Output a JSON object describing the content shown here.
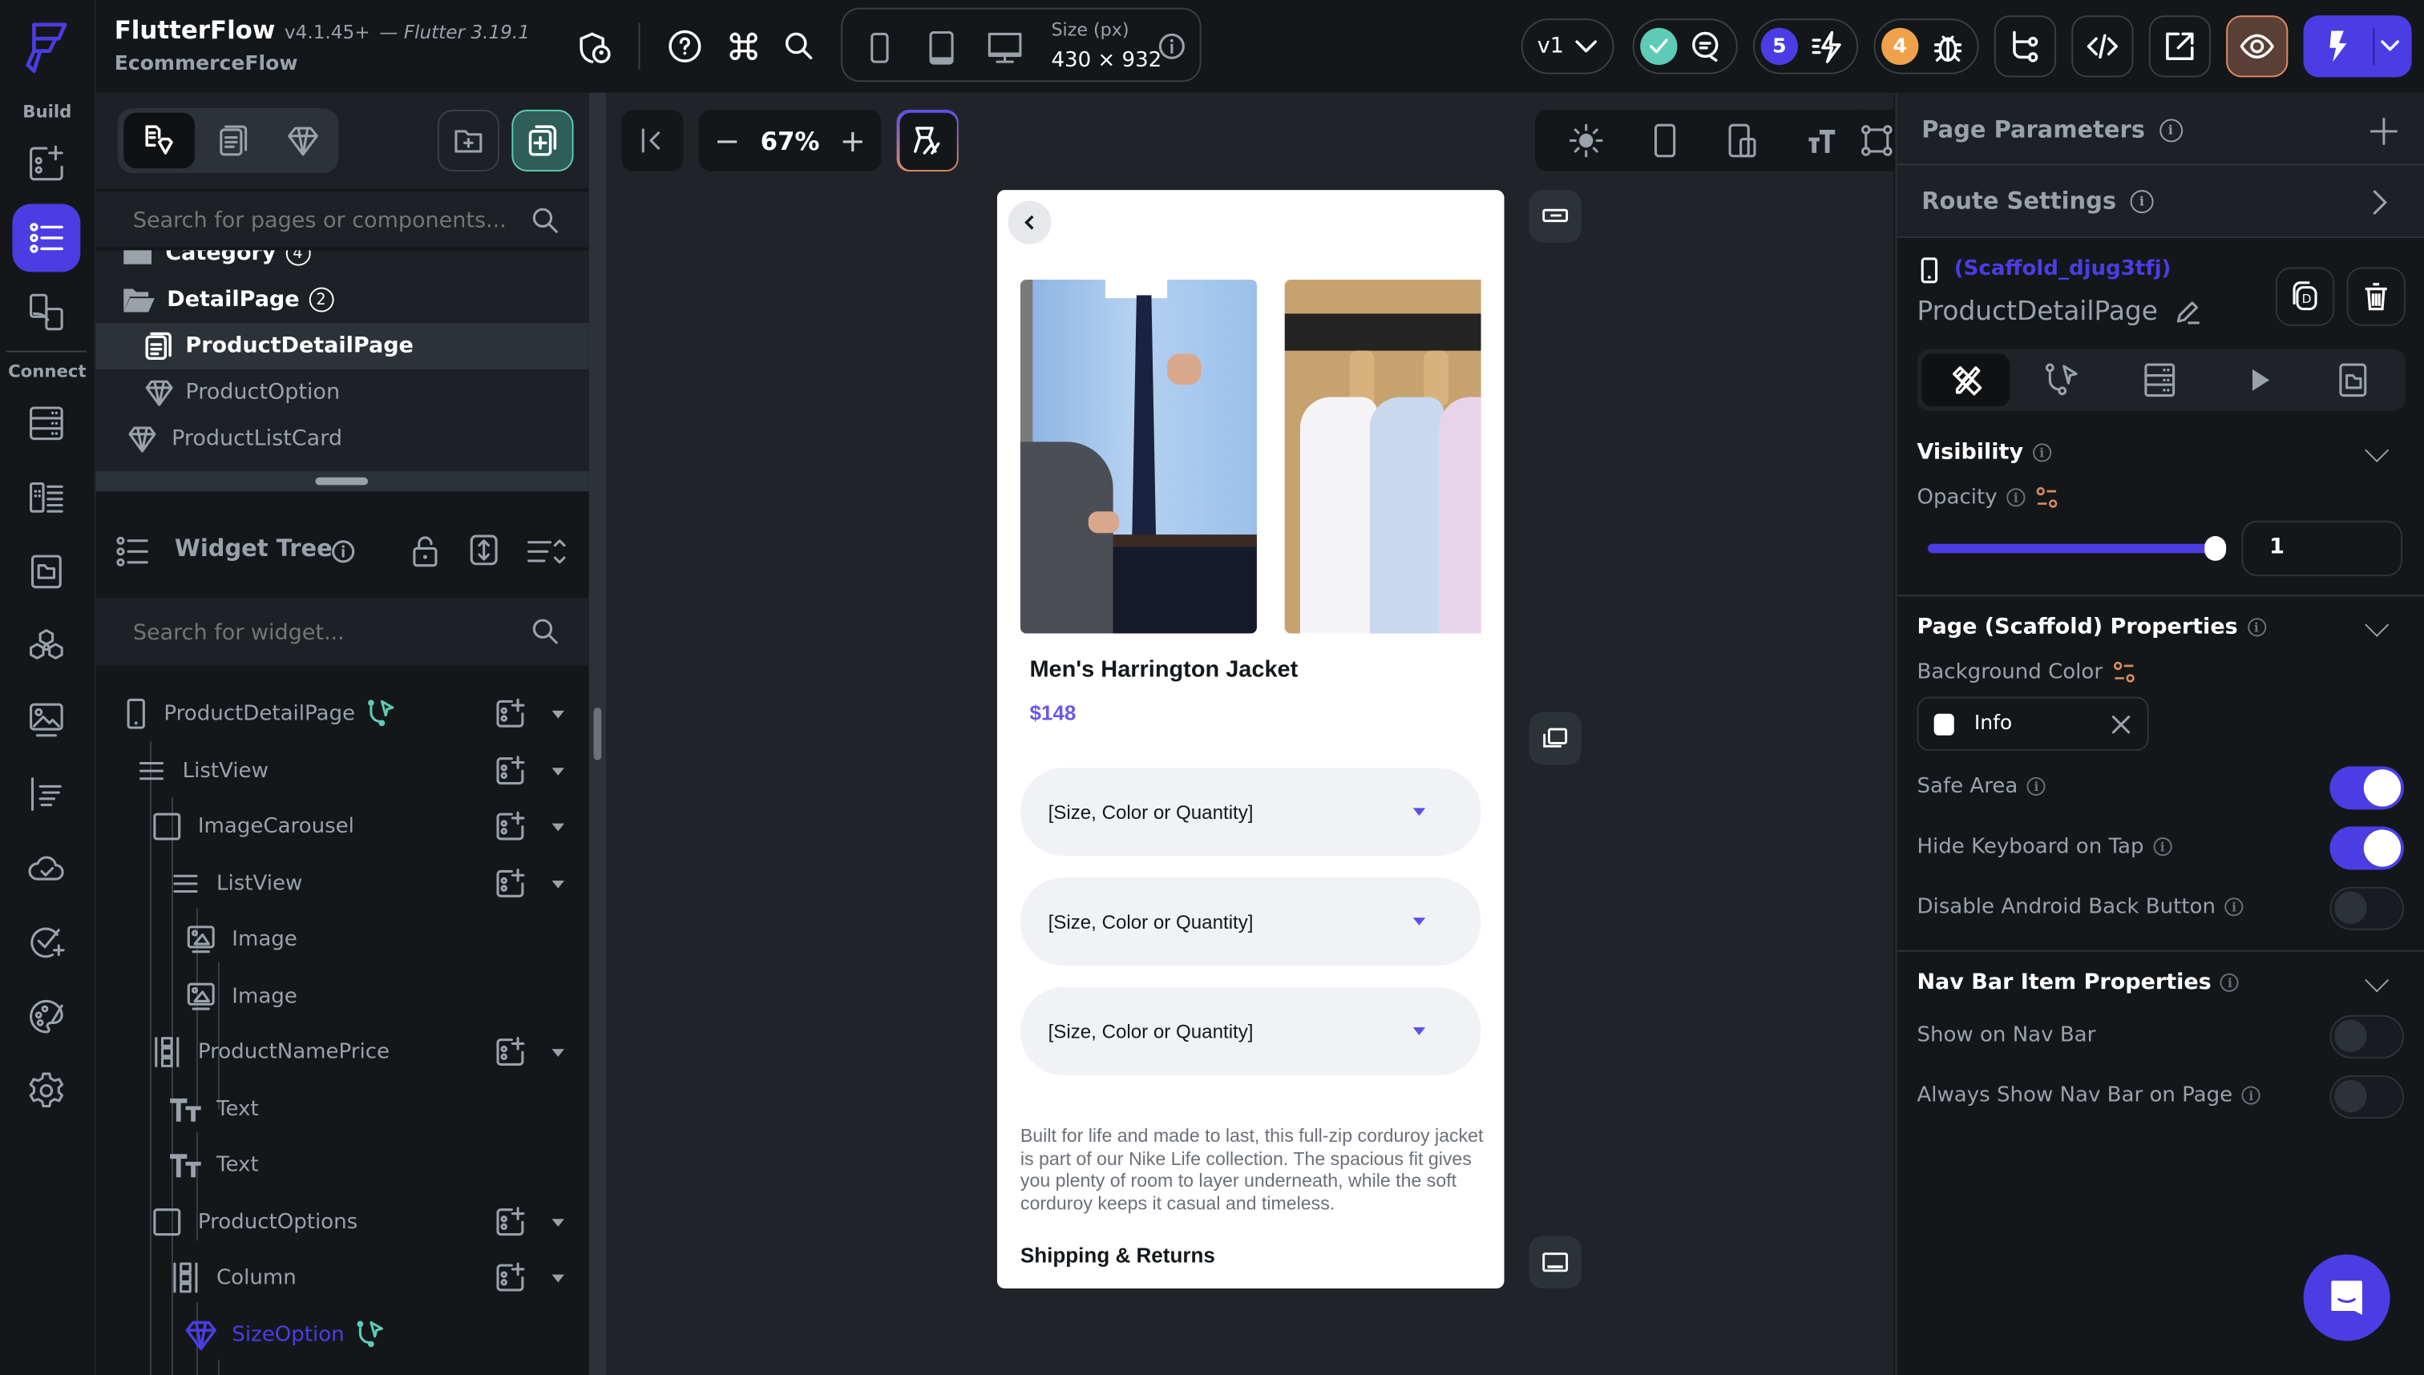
{
  "app": {
    "name": "FlutterFlow",
    "version": "v4.1.45+",
    "flutter_version": "— Flutter 3.19.1",
    "project_name": "EcommerceFlow"
  },
  "topbar": {
    "size_label": "Size (px)",
    "size_value": "430 × 932",
    "version_selector": "v1",
    "notifications_badge": "5",
    "issues_badge": "4",
    "icons": [
      "shield-user-icon",
      "help-icon",
      "command-icon",
      "search-icon",
      "phone-icon",
      "tablet-icon",
      "desktop-icon",
      "info-icon",
      "check-icon",
      "comments-icon",
      "flash-list-icon",
      "bug-icon",
      "branch-icon",
      "code-icon",
      "open-external-icon",
      "preview-eye-icon",
      "run-lightning-icon",
      "chevron-down-icon"
    ],
    "colors": {
      "accent": "#4b3de3",
      "check": "#5ecbb7",
      "issues": "#f0a24a",
      "preview_border": "#e08d65",
      "preview_bg": "#5a4036"
    }
  },
  "rail": {
    "build_label": "Build",
    "connect_label": "Connect",
    "items": [
      {
        "name": "widget-palette-icon",
        "active": false
      },
      {
        "name": "page-tree-icon",
        "active": true
      },
      {
        "name": "storyboard-icon",
        "active": false
      },
      {
        "name": "data-types-icon",
        "active": false
      },
      {
        "name": "app-state-icon",
        "active": false
      },
      {
        "name": "app-assets-icon",
        "active": false
      },
      {
        "name": "custom-code-icon",
        "active": false
      },
      {
        "name": "media-assets-icon",
        "active": false
      },
      {
        "name": "api-calls-icon",
        "active": false
      },
      {
        "name": "cloud-functions-icon",
        "active": false
      },
      {
        "name": "tests-icon",
        "active": false
      },
      {
        "name": "theme-icon",
        "active": false
      },
      {
        "name": "settings-icon",
        "active": false
      }
    ]
  },
  "pages_panel": {
    "search_placeholder": "Search for pages or components...",
    "items": [
      {
        "label": "Category",
        "count": "4",
        "type": "folder"
      },
      {
        "label": "DetailPage",
        "count": "2",
        "type": "folder-open"
      },
      {
        "label": "ProductDetailPage",
        "type": "page",
        "selected": true
      },
      {
        "label": "ProductOption",
        "type": "component"
      },
      {
        "label": "ProductListCard",
        "type": "component"
      }
    ]
  },
  "widget_tree": {
    "title": "Widget Tree",
    "search_placeholder": "Search for widget...",
    "nodes": [
      {
        "label": "ProductDetailPage",
        "icon": "phone-icon",
        "depth": 0,
        "add": true,
        "action": true
      },
      {
        "label": "ListView",
        "icon": "listview-icon",
        "depth": 1,
        "add": true
      },
      {
        "label": "ImageCarousel",
        "icon": "container-icon",
        "depth": 2,
        "add": true
      },
      {
        "label": "ListView",
        "icon": "listview-icon",
        "depth": 3,
        "add": true
      },
      {
        "label": "Image",
        "icon": "image-icon",
        "depth": 4
      },
      {
        "label": "Image",
        "icon": "image-icon",
        "depth": 4
      },
      {
        "label": "ProductNamePrice",
        "icon": "column-icon",
        "depth": 2,
        "add": true
      },
      {
        "label": "Text",
        "icon": "text-icon",
        "depth": 3
      },
      {
        "label": "Text",
        "icon": "text-icon",
        "depth": 3
      },
      {
        "label": "ProductOptions",
        "icon": "container-icon",
        "depth": 2,
        "add": true
      },
      {
        "label": "Column",
        "icon": "column-icon",
        "depth": 3,
        "add": true
      },
      {
        "label": "SizeOption",
        "icon": "component-icon",
        "depth": 4,
        "component": true,
        "action": true
      }
    ]
  },
  "canvas": {
    "zoom": "67%",
    "product": {
      "title": "Men's Harrington Jacket",
      "price": "$148",
      "options": [
        "[Size, Color or Quantity]",
        "[Size, Color or Quantity]",
        "[Size, Color or Quantity]"
      ],
      "description": "Built for life and made to last, this full-zip corduroy jacket is part of our Nike Life collection. The spacious fit gives you plenty of room to layer underneath, while the soft corduroy keeps it casual and timeless.",
      "section_heading": "Shipping & Returns",
      "images": [
        "man-shirt-tie-photo",
        "shirts-on-rack-photo"
      ]
    }
  },
  "properties": {
    "page_parameters": "Page Parameters",
    "route_settings": "Route Settings",
    "widget_id": "(Scaffold_djug3tfj)",
    "widget_name": "ProductDetailPage",
    "tabs": [
      "properties-tab",
      "actions-tab",
      "backend-query-tab",
      "animations-tab",
      "page-files-tab"
    ],
    "visibility": {
      "title": "Visibility",
      "opacity_label": "Opacity",
      "opacity_value": "1",
      "opacity_fraction": 1.0
    },
    "scaffold": {
      "title": "Page (Scaffold) Properties",
      "bg_color_label": "Background Color",
      "bg_color_value": "Info",
      "bg_color_swatch": "#ffffff",
      "safe_area": {
        "label": "Safe Area",
        "on": true
      },
      "hide_keyboard": {
        "label": "Hide Keyboard on Tap",
        "on": true
      },
      "disable_back": {
        "label": "Disable Android Back Button",
        "on": false
      }
    },
    "nav_bar": {
      "title": "Nav Bar Item Properties",
      "show_on_nav": {
        "label": "Show on Nav Bar",
        "on": false
      },
      "always_show": {
        "label": "Always Show Nav Bar on Page",
        "on": false
      }
    }
  }
}
